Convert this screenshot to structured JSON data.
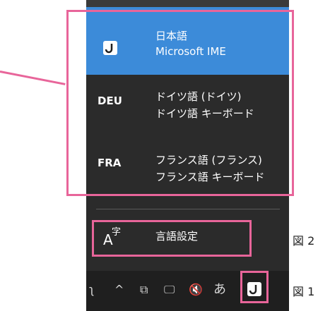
{
  "ime_list": {
    "items": [
      {
        "code_icon": "ime-j-icon",
        "line1": "日本語",
        "line2": "Microsoft IME",
        "selected": true
      },
      {
        "code": "DEU",
        "line1": "ドイツ語 (ドイツ)",
        "line2": "ドイツ語 キーボード"
      },
      {
        "code": "FRA",
        "line1": "フランス語 (フランス)",
        "line2": "フランス語 キーボード"
      }
    ]
  },
  "language_settings": {
    "icon_a": "A",
    "icon_ji": "字",
    "label": "言語設定"
  },
  "taskbar": {
    "icons": [
      "ʅ",
      "^",
      "⧉",
      "🖵",
      "🔇",
      "あ"
    ],
    "ime_mode_icon": "ime-j-icon"
  },
  "annotations": {
    "fig2": "図 2",
    "fig1": "図 1"
  },
  "colors": {
    "accent_selected": "#3c8bd9",
    "annotation": "#e8659a",
    "flyout_bg": "#2b2b2b"
  }
}
